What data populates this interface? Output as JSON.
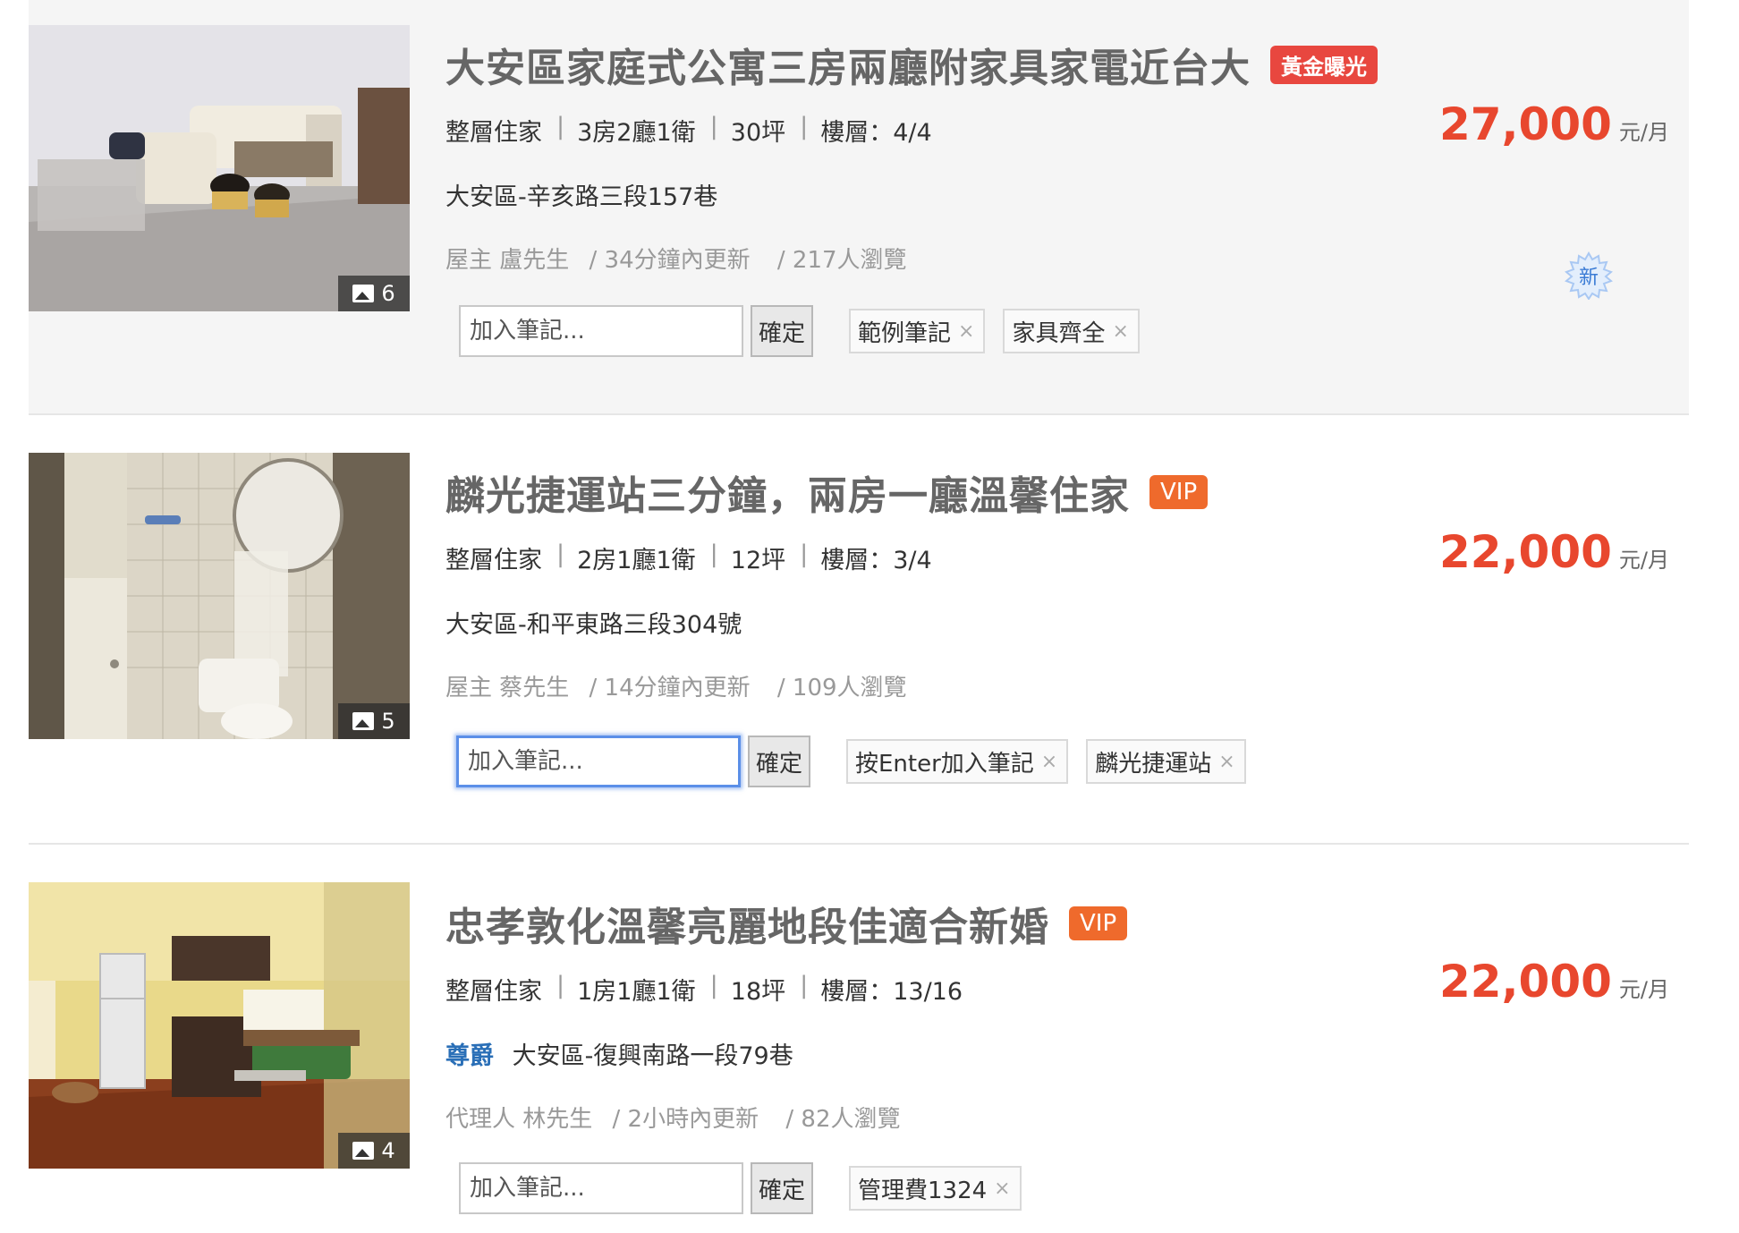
{
  "listings": [
    {
      "title": "大安區家庭式公寓三房兩廳附家具家電近台大",
      "badge": "黃金曝光",
      "specs": [
        "整層住家",
        "3房2廳1衛",
        "30坪",
        "樓層：4/4"
      ],
      "noble": "",
      "address": "大安區-辛亥路三段157巷",
      "meta": [
        "屋主 盧先生",
        "/ 34分鐘內更新",
        "/ 217人瀏覽"
      ],
      "photo_count": "6",
      "note_placeholder": "加入筆記...",
      "confirm_label": "確定",
      "tags": [
        "範例筆記",
        "家具齊全"
      ],
      "price": "27,000",
      "price_unit": "元/月",
      "new_label": "新"
    },
    {
      "title": "麟光捷運站三分鐘，兩房一廳溫馨住家",
      "badge": "VIP",
      "specs": [
        "整層住家",
        "2房1廳1衛",
        "12坪",
        "樓層：3/4"
      ],
      "noble": "",
      "address": "大安區-和平東路三段304號",
      "meta": [
        "屋主 蔡先生",
        "/ 14分鐘內更新",
        "/ 109人瀏覽"
      ],
      "photo_count": "5",
      "note_placeholder": "加入筆記...",
      "confirm_label": "確定",
      "tags": [
        "按Enter加入筆記",
        "麟光捷運站"
      ],
      "price": "22,000",
      "price_unit": "元/月"
    },
    {
      "title": "忠孝敦化溫馨亮麗地段佳適合新婚",
      "badge": "VIP",
      "specs": [
        "整層住家",
        "1房1廳1衛",
        "18坪",
        "樓層：13/16"
      ],
      "noble": "尊爵",
      "address": "大安區-復興南路一段79巷",
      "meta": [
        "代理人 林先生",
        "/ 2小時內更新",
        "/ 82人瀏覽"
      ],
      "photo_count": "4",
      "note_placeholder": "加入筆記...",
      "confirm_label": "確定",
      "tags": [
        "管理費1324"
      ],
      "price": "22,000",
      "price_unit": "元/月"
    }
  ],
  "spec_separator": "|",
  "tag_close": "×",
  "colors": {
    "price": "#e8472e",
    "badge_gold": "#e8473f",
    "badge_vip": "#ef6a2c",
    "noble": "#2a6fb7",
    "focus_ring": "#5b8fe8"
  }
}
